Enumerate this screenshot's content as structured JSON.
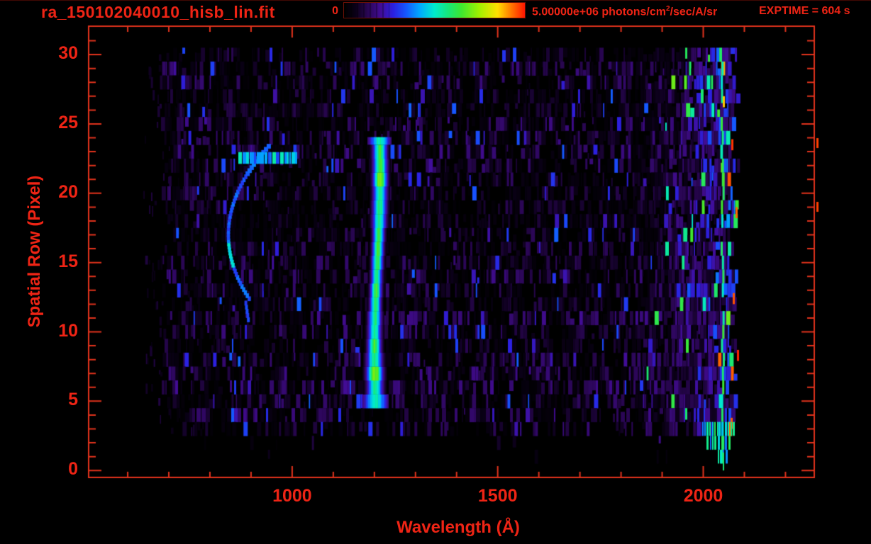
{
  "title": "ra_150102040010_hisb_lin.fit",
  "exptime_label": "EXPTIME = 604 s",
  "colorbar": {
    "min_label": "0",
    "max_label_prefix": "5.00000e+06 photons/cm",
    "max_label_sup": "2",
    "max_label_suffix": "/sec/A/sr"
  },
  "axes": {
    "x": {
      "label": "Wavelength (Å)"
    },
    "y": {
      "label": "Spatial Row (Pixel)"
    }
  },
  "colors": {
    "text_red": "#ee2415",
    "axis_red": "#e2331c",
    "background": "#000000",
    "colorbar_border": "#6b1006",
    "top_hairline": "#4a0a04"
  },
  "chart_data": {
    "type": "heatmap",
    "title": "ra_150102040010_hisb_lin.fit",
    "xlabel": "Wavelength (Å)",
    "ylabel": "Spatial Row (Pixel)",
    "x_axis": {
      "range": [
        505,
        2270
      ],
      "major_ticks": [
        1000,
        1500,
        2000
      ],
      "minor_tick_step": 100,
      "minor_tick_start": 600,
      "minor_tick_end": 2200,
      "unit": "Å"
    },
    "y_axis": {
      "range": [
        -0.5,
        32.05
      ],
      "major_ticks": [
        0,
        5,
        10,
        15,
        20,
        25,
        30
      ],
      "minor_tick_step": 1,
      "minor_tick_start": 0,
      "minor_tick_end": 31,
      "unit": "pixel row"
    },
    "colorbar": {
      "min_value": 0,
      "max_value": 5000000,
      "max_value_label": "5.00000e+06",
      "units": "photons/cm2/sec/A/sr",
      "palette": "rainbow: black-purple-blue-cyan-green-yellow-orange-red"
    },
    "exposure_time_s": 604,
    "data_extent": {
      "wavelength_angstrom": [
        700,
        2095
      ],
      "spatial_rows": [
        1,
        30
      ]
    },
    "features": [
      {
        "name": "bright-emission-line",
        "wavelength_angstrom": 1216,
        "rows": [
          5,
          24
        ],
        "appearance": "bright green vertical stripe with cyan/blue edges, slight wobble, yellow-green hot spots"
      },
      {
        "name": "curved-blue-arc",
        "wavelength_angstrom": [
          845,
          965
        ],
        "rows": [
          11,
          24
        ],
        "appearance": "thin bright blue arc bowing toward shorter wavelengths, brightest near row 15-16"
      },
      {
        "name": "blue-smear",
        "wavelength_angstrom": [
          880,
          1015
        ],
        "rows": [
          21.5,
          23.2
        ],
        "appearance": "bright blue/cyan horizontal patch at arc top"
      },
      {
        "name": "long-wavelength-bright-band",
        "wavelength_angstrom": [
          1870,
          2095
        ],
        "rows": [
          1,
          30
        ],
        "appearance": "noisy blue/cyan/green band with sparse orange and red spikes near the data edge"
      },
      {
        "name": "background-noise",
        "appearance": "dark purple/violet vertical striations on black, ragged left edge, sparse below row 3"
      }
    ],
    "colormap_stops": [
      [
        0.0,
        0,
        0,
        0
      ],
      [
        0.06,
        10,
        0,
        22
      ],
      [
        0.13,
        42,
        6,
        84
      ],
      [
        0.2,
        66,
        12,
        148
      ],
      [
        0.27,
        44,
        32,
        224
      ],
      [
        0.34,
        22,
        84,
        255
      ],
      [
        0.42,
        0,
        170,
        255
      ],
      [
        0.5,
        0,
        235,
        205
      ],
      [
        0.58,
        24,
        232,
        118
      ],
      [
        0.65,
        62,
        232,
        48
      ],
      [
        0.75,
        162,
        240,
        0
      ],
      [
        0.85,
        255,
        224,
        0
      ],
      [
        0.92,
        255,
        128,
        0
      ],
      [
        1.0,
        255,
        24,
        0
      ]
    ],
    "render_seed": 20150102
  }
}
